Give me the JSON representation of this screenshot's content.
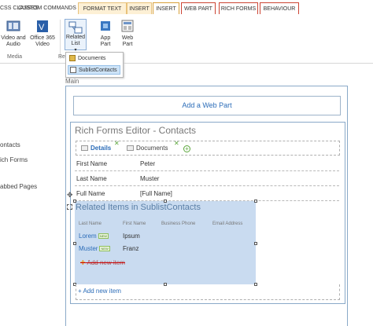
{
  "ribbon": {
    "tabs": [
      {
        "label": "CSS CLASSES"
      },
      {
        "label": "CUSTOM COMMANDS"
      },
      {
        "label": "FORMAT TEXT"
      },
      {
        "label": "INSERT"
      },
      {
        "label": "INSERT"
      },
      {
        "label": "WEB PART"
      },
      {
        "label": "RICH FORMS"
      },
      {
        "label": "BEHAVIOUR"
      }
    ],
    "buttons": {
      "video_audio": "Video and Audio",
      "office_video": "Office 365 Video",
      "related_list": "Related List",
      "app_part": "App Part",
      "web_part": "Web Part"
    },
    "groups": {
      "media": "Media",
      "re": "Re"
    },
    "related_menu": {
      "items": [
        "Documents",
        "SublistContacts"
      ]
    }
  },
  "left_nav": {
    "items": [
      "ontacts",
      "ich Forms",
      "abbed Pages"
    ]
  },
  "main": {
    "zone_label": "Main",
    "add_web_part": "Add a Web Part",
    "editor": {
      "title": "Rich Forms Editor - Contacts",
      "tabs": [
        "Details",
        "Documents"
      ],
      "fields": [
        {
          "label": "First Name",
          "value": "Peter"
        },
        {
          "label": "Last Name",
          "value": "Muster"
        },
        {
          "label": "Full Name",
          "value": "[Full Name]"
        }
      ],
      "related": {
        "title": "Related Items in SublistContacts",
        "columns": [
          "Last Name",
          "First Name",
          "Business Phone",
          "Email Address"
        ],
        "rows": [
          {
            "last": "Lorem",
            "first": "Ipsum",
            "badge": "NEW"
          },
          {
            "last": "Muster",
            "first": "Franz",
            "badge": "NEW"
          }
        ],
        "add_new_item_struck": "Add new item"
      },
      "add_new_item": "+ Add new item"
    }
  },
  "colors": {
    "accent": "#2b6cb8",
    "related_bg": "#c9dbf0",
    "tab_context": "#fdf0d5"
  }
}
